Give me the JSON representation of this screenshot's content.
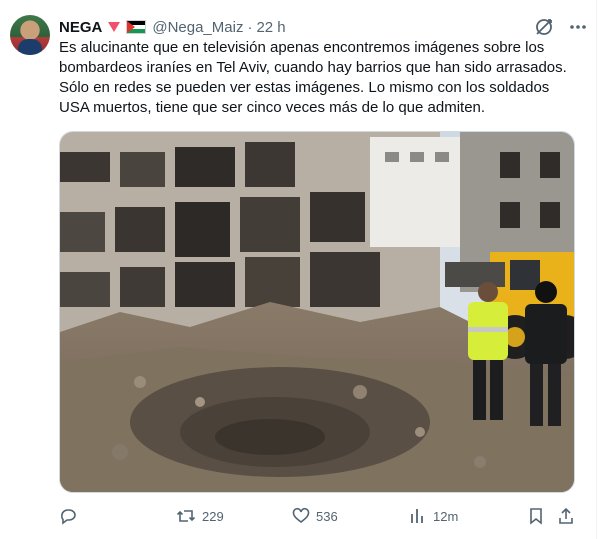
{
  "tweet": {
    "author_name": "NEGA",
    "handle": "@Nega_Maiz",
    "separator": "·",
    "time": "22 h",
    "text": "Es alucinante que en televisión apenas encontremos imágenes sobre los bombardeos iraníes en Tel Aviv, cuando hay barrios que han sido arrasados. Sólo en redes se pueden ver estas imágenes. Lo mismo con los soldados USA muertos, tiene que ser cinco veces más de lo que admiten.",
    "badges": [
      "red-triangle-emoji",
      "palestine-flag-emoji"
    ]
  },
  "actions": {
    "reply_count": "",
    "retweet_count": "229",
    "like_count": "536",
    "views_count": "12m"
  },
  "icons": {
    "grok": "grok-icon",
    "more": "more-icon",
    "reply": "reply-icon",
    "retweet": "retweet-icon",
    "like": "heart-icon",
    "views": "views-icon",
    "bookmark": "bookmark-icon",
    "share": "share-icon"
  },
  "colors": {
    "text": "#0f1419",
    "secondary": "#536471",
    "border": "#cfd9de"
  }
}
